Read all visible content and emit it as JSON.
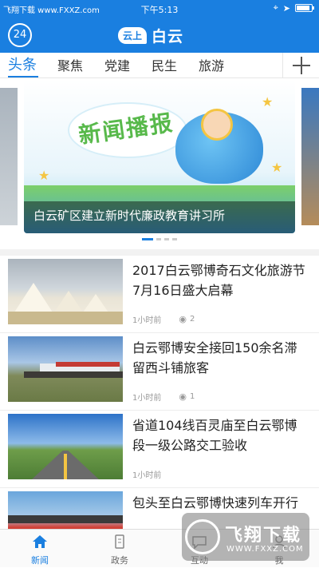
{
  "status_bar": {
    "carrier": "飞翔下载 www.FXXZ.com",
    "time": "下午5:13"
  },
  "header": {
    "weather_badge": "24",
    "logo_mark": "云上",
    "logo_name": "白云"
  },
  "tabs": [
    "头条",
    "聚焦",
    "党建",
    "民生",
    "旅游"
  ],
  "carousel": {
    "art_text": "新闻播报",
    "caption": "白云矿区建立新时代廉政教育讲习所",
    "slide_count": 4,
    "active_index": 0
  },
  "news": [
    {
      "title": "2017白云鄂博奇石文化旅游节7月16日盛大启幕",
      "time": "1小时前",
      "views": "2"
    },
    {
      "title": "白云鄂博安全接回150余名滞留西斗铺旅客",
      "time": "1小时前",
      "views": "1"
    },
    {
      "title": "省道104线百灵庙至白云鄂博段一级公路交工验收",
      "time": "1小时前",
      "views": ""
    },
    {
      "title": "包头至白云鄂博快速列车开行",
      "time": "",
      "views": ""
    }
  ],
  "tabbar": [
    "新闻",
    "政务",
    "互动",
    "我"
  ],
  "watermark": {
    "text": "飞翔下载",
    "url": "WWW.FXXZ.COM"
  },
  "colors": {
    "accent": "#1a7fe0"
  }
}
